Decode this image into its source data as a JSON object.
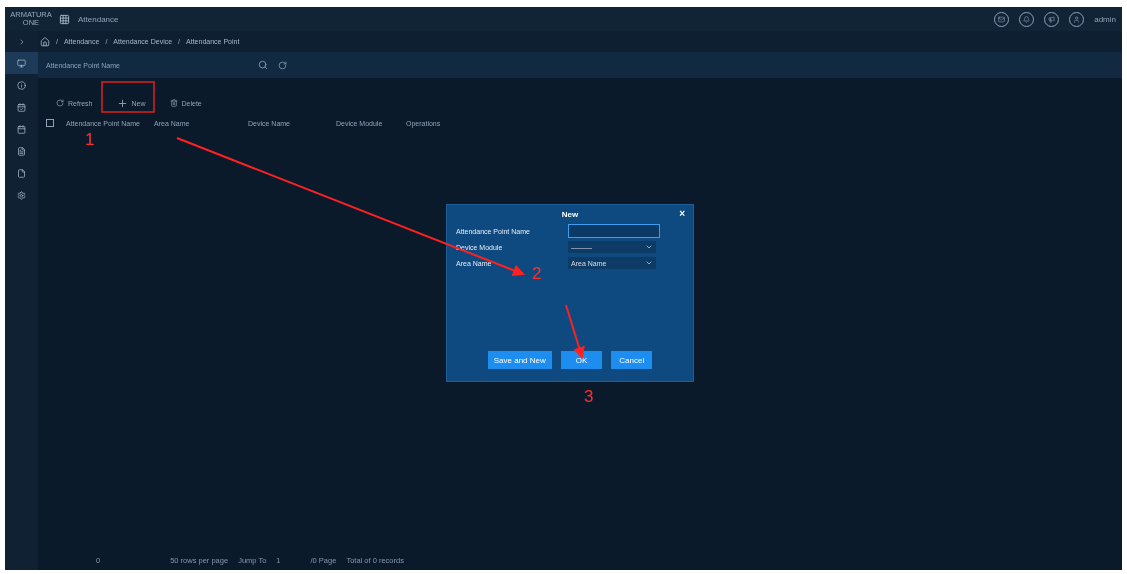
{
  "topbar": {
    "logo": [
      "ARMATURA",
      "ONE"
    ],
    "title": "Attendance",
    "user": "admin"
  },
  "breadcrumb": {
    "separator": "/",
    "items": [
      "Attendance",
      "Attendance Device",
      "Attendance Point"
    ]
  },
  "search": {
    "placeholder": "Attendance Point Name"
  },
  "toolbar": [
    "Refresh",
    "New",
    "Delete"
  ],
  "table": {
    "select_all": {
      "checked": false
    },
    "columns": [
      "Attendance Point Name",
      "Area Name",
      "Device Name",
      "Device Module",
      "Operations"
    ]
  },
  "sidebar": {
    "items": [
      {
        "selected": true
      },
      {
        "selected": false
      },
      {
        "selected": false
      },
      {
        "selected": false
      },
      {
        "selected": false
      },
      {
        "selected": false
      },
      {
        "selected": false
      }
    ]
  },
  "pagination": {
    "page": "0",
    "rows_per_page": "50 rows per page",
    "jump_label": "Jump To",
    "jump_value": "1",
    "pages": "/0 Page",
    "total": "Total of 0 records"
  },
  "dialog": {
    "title": "New",
    "close": "×",
    "fields": [
      {
        "kind": "input",
        "label": "Attendance Point Name"
      },
      {
        "kind": "select",
        "label": "Device Module",
        "value": "———"
      },
      {
        "kind": "select",
        "label": "Area Name",
        "value": "Area Name"
      }
    ],
    "buttons": [
      "Save and New",
      "OK",
      "Cancel"
    ]
  },
  "annotations": {
    "steps": [
      "1",
      "2",
      "3"
    ]
  }
}
